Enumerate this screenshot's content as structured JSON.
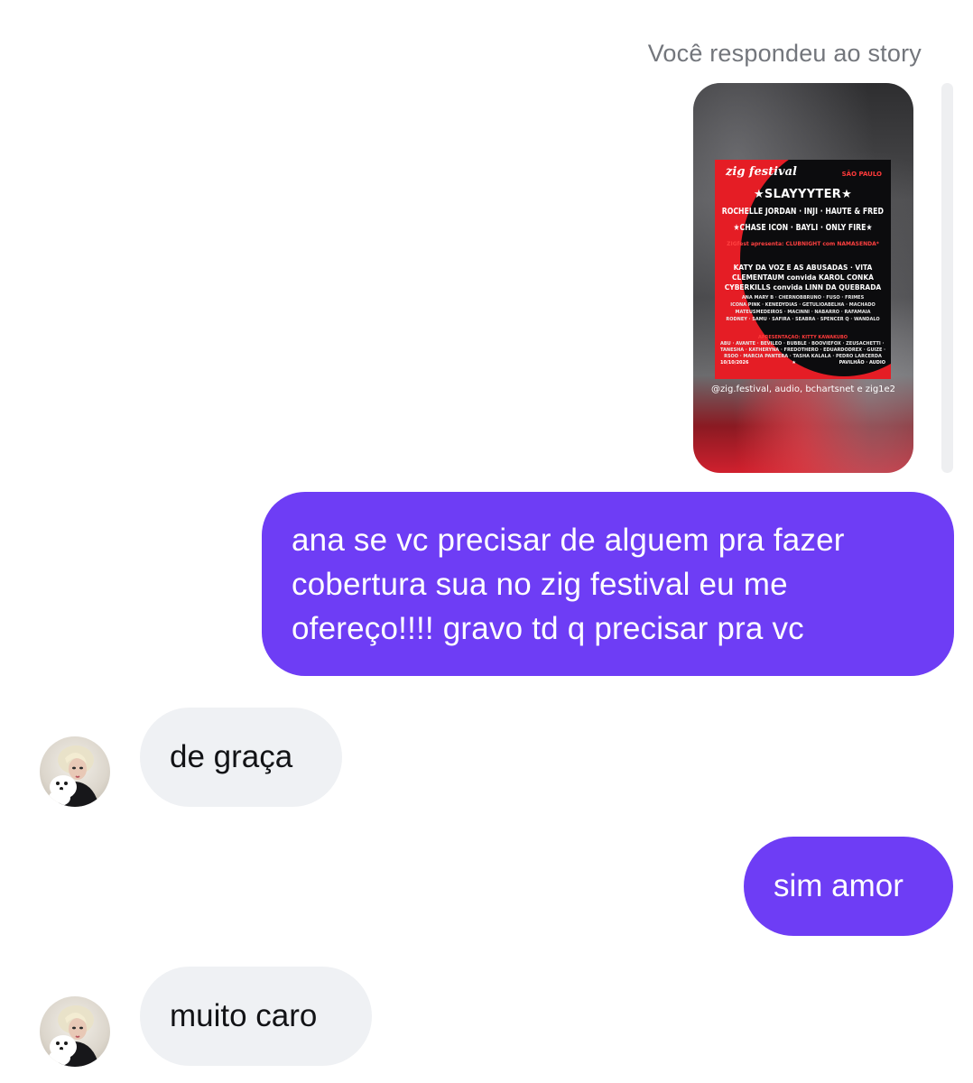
{
  "story_reply": {
    "caption": "Você respondeu ao story",
    "poster": {
      "logo": "zig festival",
      "city": "SÃO PAULO",
      "headliner": "★SLAYYYTER★",
      "line2": "ROCHELLE JORDAN · INJI · HAUTE & FREDDY",
      "line3": "★CHASE ICON · BAYLI · ONLY FIRE★",
      "line4": "ZIGfest apresenta: CLUBNIGHT com NAMASENDA*",
      "line5": "KATY DA VOZ E AS ABUSADAS · VITA",
      "line6": "CLEMENTAUM convida KAROL CONKÁ",
      "line7": "CYBERKILLS convida LINN DA QUEBRADA",
      "line8": "ANA MARY B · CHERNOBBRUNO · FUSO · FRIMES",
      "line9": "ICONA PINK · KENEDYDIAS · GETULIOABELHA · MACHADO",
      "line10": "MATEUSMEDEIROS · MACINNI · NABARRO · RAFAMAIA",
      "line11": "RODNEY · SAMU · SÁFIRA · SEABRA · SPENCER Q · WANDALO",
      "line12": "APRESENTAÇÃO: KITTY KAWAKUBO",
      "line13": "ABU · AVANTE · BEVILEO · BUBBLE · BOOVIEFOX · ZEUSACHETTI · ZAILA",
      "line14": "TANESHA · KATHERYNA · FREDOTHERO · EDUARDODREX · GUIZE · GOODY",
      "line15": "RSOO · MARCIA PANTERA · TASHA KALALA · PEDRO LARCERDA",
      "date": "10/10/2026",
      "venue": "PAVILHÃO · AUDIO",
      "credit": "@zig.festival, audio, bchartsnet e zig1e2"
    }
  },
  "messages": [
    {
      "direction": "outgoing",
      "text": "ana se vc precisar de alguem pra fazer cobertura sua no zig festival eu me ofereço!!!! gravo td q precisar pra vc"
    },
    {
      "direction": "incoming",
      "text": "de graça"
    },
    {
      "direction": "outgoing",
      "text": "sim amor"
    },
    {
      "direction": "incoming",
      "text": "muito caro"
    }
  ],
  "colors": {
    "outgoing_bubble": "#6e3df5",
    "incoming_bubble": "#eff1f4",
    "caption_text": "#73767c"
  },
  "icons": {
    "avatar": "contact-avatar"
  }
}
